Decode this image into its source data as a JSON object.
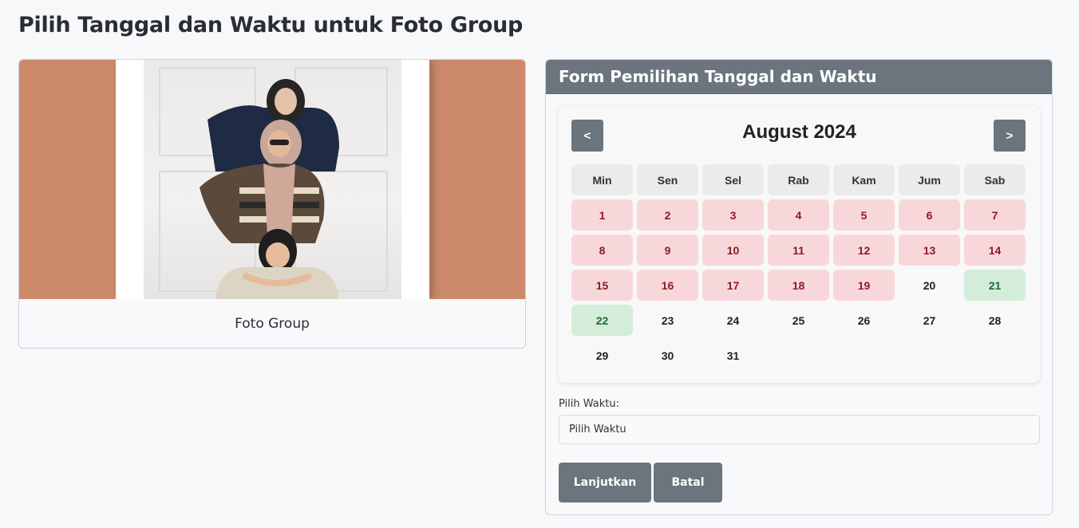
{
  "page": {
    "title": "Pilih Tanggal dan Waktu untuk Foto Group"
  },
  "photo_card": {
    "caption": "Foto Group",
    "image_icon": "group-photo-image"
  },
  "form": {
    "header": "Form Pemilihan Tanggal dan Waktu",
    "calendar": {
      "month_label": "August 2024",
      "prev_label": "<",
      "next_label": ">",
      "weekdays": [
        "Min",
        "Sen",
        "Sel",
        "Rab",
        "Kam",
        "Jum",
        "Sab"
      ],
      "days": [
        {
          "day": "1",
          "status": "booked"
        },
        {
          "day": "2",
          "status": "booked"
        },
        {
          "day": "3",
          "status": "booked"
        },
        {
          "day": "4",
          "status": "booked"
        },
        {
          "day": "5",
          "status": "booked"
        },
        {
          "day": "6",
          "status": "booked"
        },
        {
          "day": "7",
          "status": "booked"
        },
        {
          "day": "8",
          "status": "booked"
        },
        {
          "day": "9",
          "status": "booked"
        },
        {
          "day": "10",
          "status": "booked"
        },
        {
          "day": "11",
          "status": "booked"
        },
        {
          "day": "12",
          "status": "booked"
        },
        {
          "day": "13",
          "status": "booked"
        },
        {
          "day": "14",
          "status": "booked"
        },
        {
          "day": "15",
          "status": "booked"
        },
        {
          "day": "16",
          "status": "booked"
        },
        {
          "day": "17",
          "status": "booked"
        },
        {
          "day": "18",
          "status": "booked"
        },
        {
          "day": "19",
          "status": "booked"
        },
        {
          "day": "20",
          "status": "plain"
        },
        {
          "day": "21",
          "status": "available"
        },
        {
          "day": "22",
          "status": "available"
        },
        {
          "day": "23",
          "status": "plain"
        },
        {
          "day": "24",
          "status": "plain"
        },
        {
          "day": "25",
          "status": "plain"
        },
        {
          "day": "26",
          "status": "plain"
        },
        {
          "day": "27",
          "status": "plain"
        },
        {
          "day": "28",
          "status": "plain"
        },
        {
          "day": "29",
          "status": "plain"
        },
        {
          "day": "30",
          "status": "plain"
        },
        {
          "day": "31",
          "status": "plain"
        }
      ]
    },
    "time_label": "Pilih Waktu:",
    "time_select_value": "Pilih Waktu",
    "continue_button": "Lanjutkan",
    "cancel_button": "Batal"
  },
  "colors": {
    "header_bg": "#6c757d",
    "booked_bg": "#f8d7da",
    "available_bg": "#d4edda",
    "photo_bg": "#cd8a6b"
  }
}
